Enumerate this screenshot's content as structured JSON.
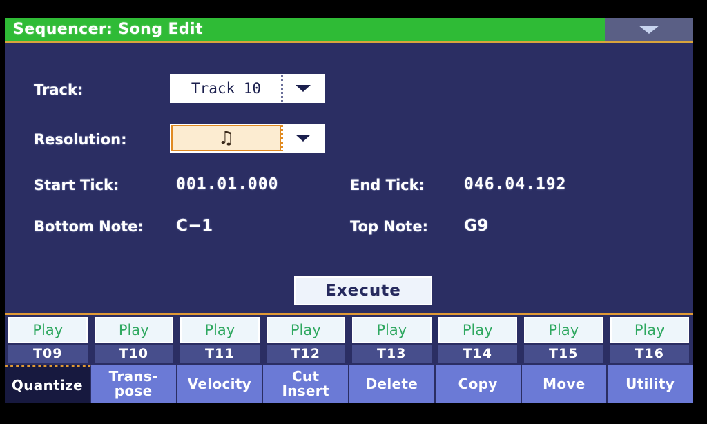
{
  "titlebar": {
    "title": "Sequencer: Song Edit",
    "menu_icon": "chevron-down-icon"
  },
  "form": {
    "track": {
      "label": "Track:",
      "value": "Track 10",
      "arrow_icon": "chevron-down-icon"
    },
    "resolution": {
      "label": "Resolution:",
      "value": "♫",
      "value_desc": "thirty-second-note",
      "arrow_icon": "chevron-down-icon",
      "selected": true
    },
    "start_tick": {
      "label": "Start Tick:",
      "value": "001.01.000"
    },
    "end_tick": {
      "label": "End Tick:",
      "value": "046.04.192"
    },
    "bottom_note": {
      "label": "Bottom Note:",
      "value": "C−1"
    },
    "top_note": {
      "label": "Top Note:",
      "value": "G9"
    },
    "execute": {
      "label": "Execute"
    }
  },
  "tracks": [
    {
      "play": "Play",
      "name": "T09"
    },
    {
      "play": "Play",
      "name": "T10"
    },
    {
      "play": "Play",
      "name": "T11"
    },
    {
      "play": "Play",
      "name": "T12"
    },
    {
      "play": "Play",
      "name": "T13"
    },
    {
      "play": "Play",
      "name": "T14"
    },
    {
      "play": "Play",
      "name": "T15"
    },
    {
      "play": "Play",
      "name": "T16"
    }
  ],
  "tabs": [
    {
      "label": "Quantize",
      "active": true
    },
    {
      "label": "Trans-\npose",
      "active": false
    },
    {
      "label": "Velocity",
      "active": false
    },
    {
      "label": "Cut\nInsert",
      "active": false
    },
    {
      "label": "Delete",
      "active": false
    },
    {
      "label": "Copy",
      "active": false
    },
    {
      "label": "Move",
      "active": false
    },
    {
      "label": "Utility",
      "active": false
    }
  ],
  "colors": {
    "title_bar": "#2fbb36",
    "panel": "#2b2e63",
    "accent_orange": "#e09a35",
    "tab_inactive": "#6b7ad6",
    "tab_active": "#17193f",
    "play_text": "#2fa860",
    "highlight_field": "#fcecd1"
  }
}
